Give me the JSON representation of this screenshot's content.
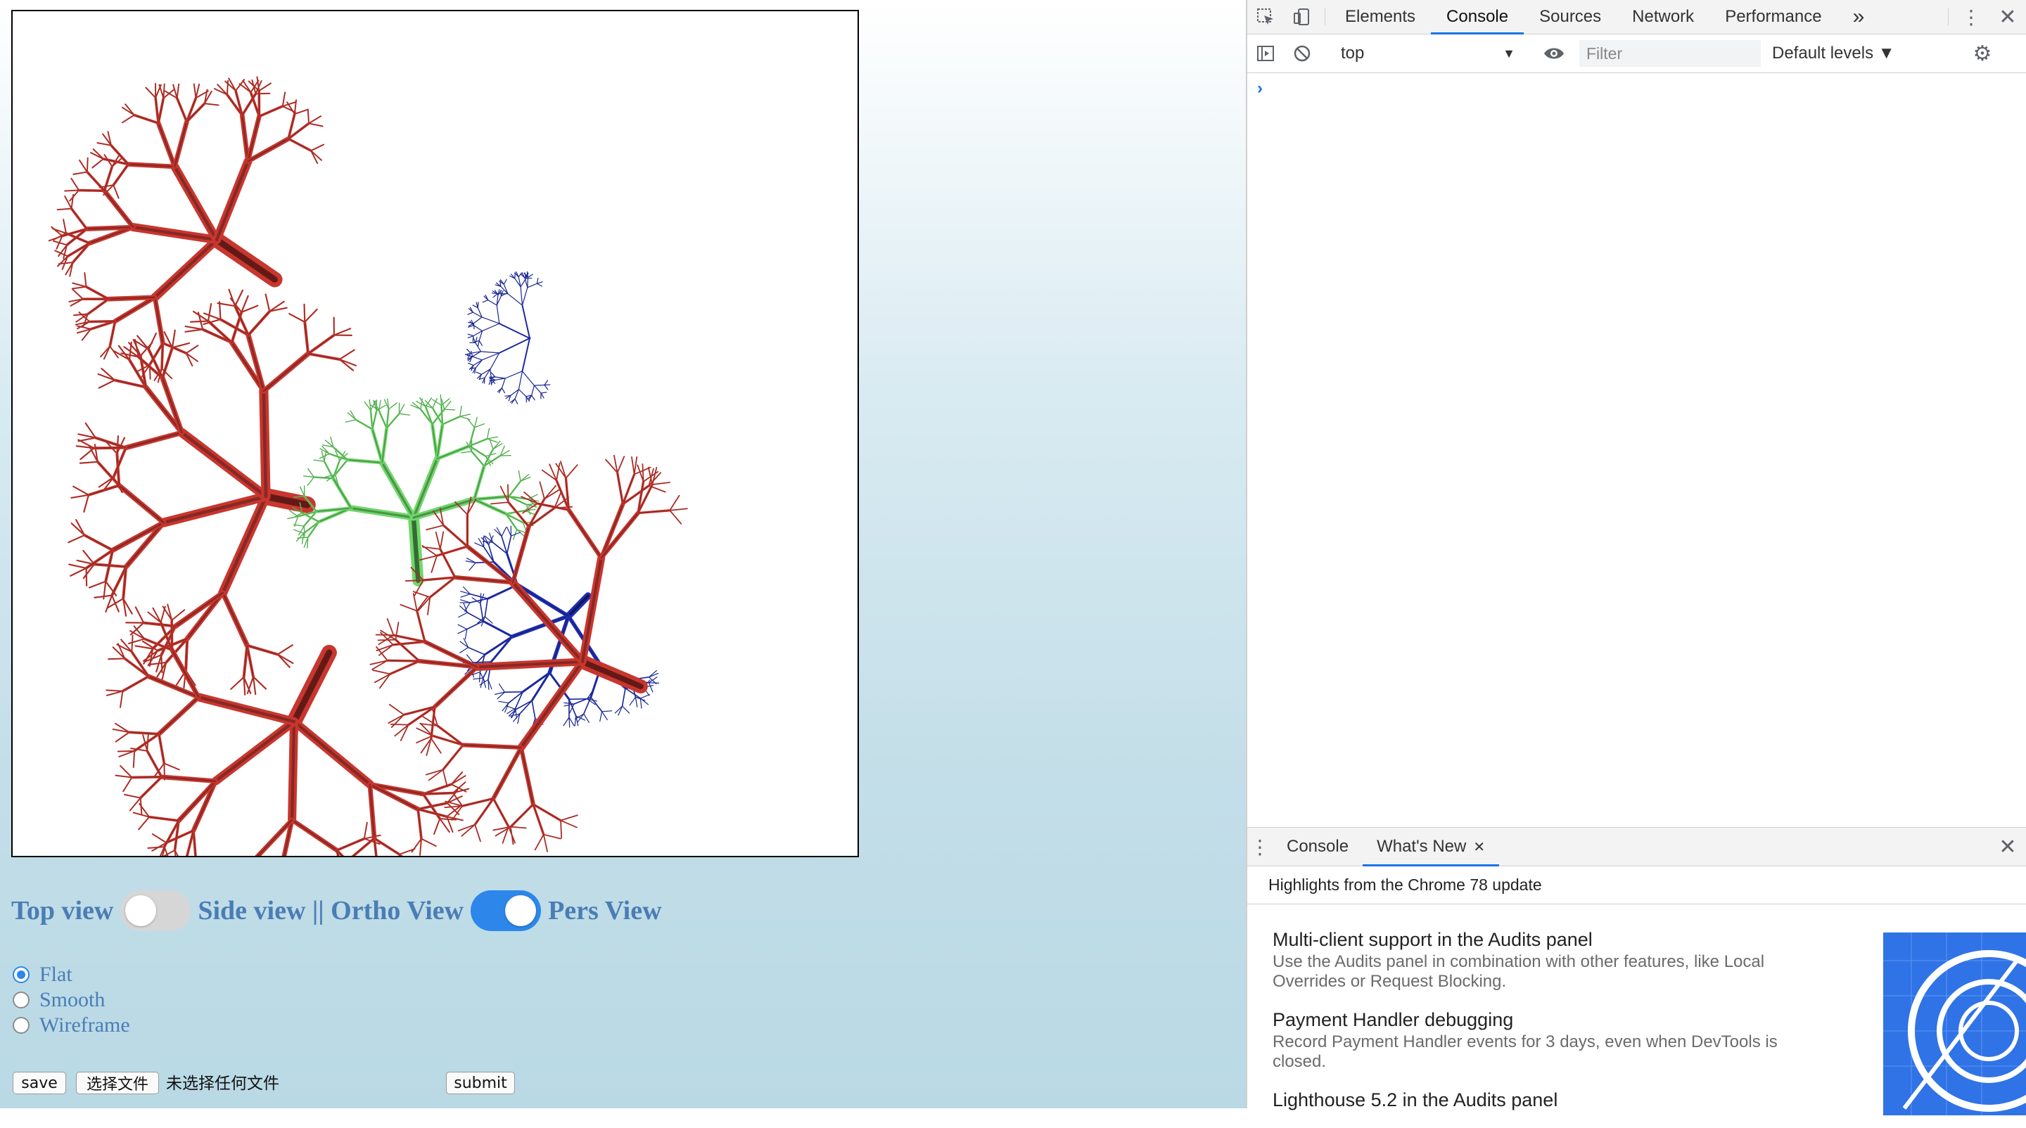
{
  "view_controls": {
    "top_view": "Top view",
    "side_view": "Side view || Ortho View",
    "pers_view": "Pers View",
    "toggle1_on": false,
    "toggle2_on": true
  },
  "shading": {
    "options": [
      "Flat",
      "Smooth",
      "Wireframe"
    ],
    "selected": "Flat"
  },
  "file": {
    "save_label": "save",
    "choose_label": "选择文件",
    "no_file_text": "未选择任何文件",
    "submit_label": "submit"
  },
  "devtools": {
    "tabs": [
      "Elements",
      "Console",
      "Sources",
      "Network",
      "Performance"
    ],
    "active_tab": "Console",
    "more": "»",
    "context": "top",
    "filter_placeholder": "Filter",
    "levels": "Default levels ▼",
    "prompt": "›",
    "drawer_tabs": [
      "Console",
      "What's New"
    ],
    "drawer_active": "What's New",
    "highlights": "Highlights from the Chrome 78 update",
    "news": [
      {
        "title": "Multi-client support in the Audits panel",
        "desc": "Use the Audits panel in combination with other features, like Local Overrides or Request Blocking."
      },
      {
        "title": "Payment Handler debugging",
        "desc": "Record Payment Handler events for 3 days, even when DevTools is closed."
      },
      {
        "title": "Lighthouse 5.2 in the Audits panel",
        "desc": ""
      }
    ]
  },
  "colors": {
    "label_blue": "#4a7db5",
    "toggle_on": "#2d87ea",
    "red_tree": "#c8362e",
    "green_tree": "#6fd86a",
    "blue_tree": "#1f2fb8"
  }
}
